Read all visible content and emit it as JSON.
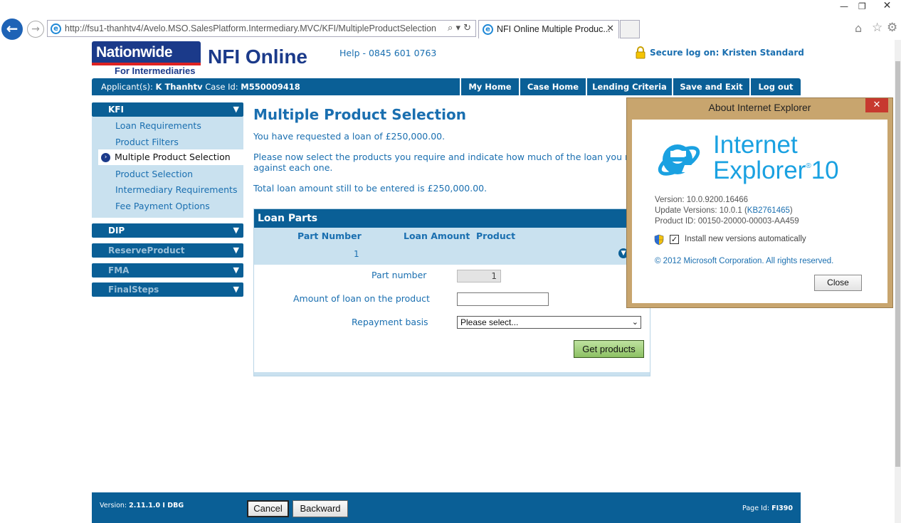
{
  "browser": {
    "url": "http://fsu1-thanhtv4/Avelo.MSO.SalesPlatform.Intermediary.MVC/KFI/MultipleProductSelection",
    "tab_title": "NFI Online Multiple Produc...",
    "icons": [
      "back-arrow-icon",
      "forward-arrow-icon",
      "search-icon",
      "refresh-icon",
      "home-icon",
      "star-icon",
      "gear-icon"
    ]
  },
  "header": {
    "logo_text": "Nationwide",
    "logo_sub": "For Intermediaries",
    "site_title": "NFI Online",
    "help": "Help - 0845 601 0763",
    "secure": "Secure log on: Kristen Standard"
  },
  "navbar": {
    "applicant_label": "Applicant(s):",
    "applicant_name": "K Thanhtv",
    "case_label": "Case Id:",
    "case_id": "M550009418",
    "buttons": [
      "My Home",
      "Case Home",
      "Lending Criteria",
      "Save and Exit",
      "Log out"
    ]
  },
  "sidebar": {
    "kfi": "KFI",
    "items": [
      "Loan Requirements",
      "Product Filters",
      "Multiple Product Selection",
      "Product Selection",
      "Intermediary Requirements",
      "Fee Payment Options"
    ],
    "active_index": 2,
    "sections": [
      "DIP",
      "ReserveProduct",
      "FMA",
      "FinalSteps"
    ]
  },
  "main": {
    "title": "Multiple Product Selection",
    "p1": "You have requested a loan of £250,000.00.",
    "p2a": "Please now select the products you require and indicate how much of the loan you require",
    "p2b": "against each one.",
    "p3": "Total loan amount still to be entered is £250,000.00.",
    "loan_parts": {
      "title": "Loan Parts",
      "columns": [
        "Part Number",
        "Loan Amount",
        "Product"
      ],
      "row_part": "1",
      "part_number_label": "Part number",
      "part_number_value": "1",
      "amount_label": "Amount of loan on the product",
      "amount_value": "",
      "repayment_label": "Repayment basis",
      "repayment_value": "Please select...",
      "get_products": "Get products"
    }
  },
  "footer": {
    "version_label": "Version:",
    "version": "2.11.1.0 I DBG",
    "cancel": "Cancel",
    "backward": "Backward",
    "page_id_label": "Page Id:",
    "page_id": "FI390"
  },
  "about_dialog": {
    "title": "About Internet Explorer",
    "product_line1": "Internet",
    "product_line2": "Explorer",
    "product_version": "10",
    "version": "Version: 10.0.9200.16466",
    "update_prefix": "Update Versions: 10.0.1 (",
    "update_kb": "KB2761465",
    "update_suffix": ")",
    "product_id": "Product ID: 00150-20000-00003-AA459",
    "auto_update": "Install new versions automatically",
    "auto_update_checked": true,
    "copyright": "© 2012 Microsoft Corporation. All rights reserved.",
    "close": "Close"
  }
}
